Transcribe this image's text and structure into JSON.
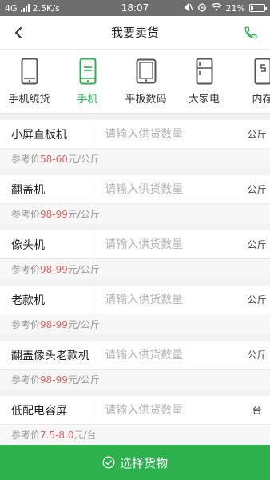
{
  "status_bar": {
    "network": "4G",
    "speed": "2.5K/s",
    "time": "18:07",
    "battery": "21%"
  },
  "nav": {
    "title": "我要卖货"
  },
  "categories": [
    {
      "label": "手机统货",
      "icon": "phone-outline-icon",
      "active": false
    },
    {
      "label": "手机",
      "icon": "phone-list-icon",
      "active": true
    },
    {
      "label": "平板数码",
      "icon": "tablet-icon",
      "active": false
    },
    {
      "label": "大家电",
      "icon": "fridge-icon",
      "active": false
    },
    {
      "label": "内存",
      "icon": "memory-icon",
      "active": false
    }
  ],
  "items": [
    {
      "name": "小屏直板机",
      "placeholder": "请输入供货数量",
      "unit": "公斤",
      "ref_label": "参考价 ",
      "price": "58-60",
      "price_unit": "元/公斤"
    },
    {
      "name": "翻盖机",
      "placeholder": "请输入供货数量",
      "unit": "公斤",
      "ref_label": "参考价 ",
      "price": "98-99",
      "price_unit": "元/公斤"
    },
    {
      "name": "像头机",
      "placeholder": "请输入供货数量",
      "unit": "公斤",
      "ref_label": "参考价 ",
      "price": "98-99",
      "price_unit": "元/公斤"
    },
    {
      "name": "老款机",
      "placeholder": "请输入供货数量",
      "unit": "公斤",
      "ref_label": "参考价 ",
      "price": "98-99",
      "price_unit": "元/公斤"
    },
    {
      "name": "翻盖像头老款机",
      "placeholder": "请输入供货数量",
      "unit": "公斤",
      "ref_label": "参考价 ",
      "price": "98-99",
      "price_unit": "元/公斤"
    },
    {
      "name": "低配电容屏",
      "placeholder": "请输入供货数量",
      "unit": "台",
      "ref_label": "参考价 ",
      "price": "7.5-8.0",
      "price_unit": "元/台"
    }
  ],
  "bottom_button": {
    "label": "选择货物"
  },
  "colors": {
    "accent": "#2bb24c",
    "price": "#f25c5c",
    "status_bar": "#6e6e6e"
  }
}
